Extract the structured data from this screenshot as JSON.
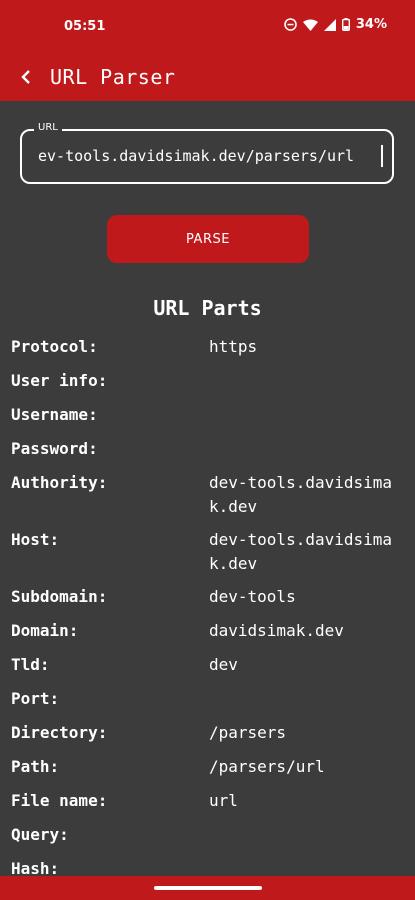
{
  "status": {
    "time": "05:51",
    "battery": "34%",
    "icons": [
      "do-not-disturb-icon",
      "wifi-icon",
      "signal-icon",
      "battery-icon"
    ]
  },
  "appbar": {
    "title": "URL Parser",
    "back_icon": "chevron-left-icon"
  },
  "url_input": {
    "label": "URL",
    "value": "ev-tools.davidsimak.dev/parsers/url"
  },
  "parse_button": {
    "label": "PARSE"
  },
  "results": {
    "title": "URL Parts",
    "rows": [
      {
        "key": "Protocol:",
        "value": "https"
      },
      {
        "key": "User info:",
        "value": ""
      },
      {
        "key": "Username:",
        "value": ""
      },
      {
        "key": "Password:",
        "value": ""
      },
      {
        "key": "Authority:",
        "value": "dev-tools.davidsimak.dev"
      },
      {
        "key": "Host:",
        "value": "dev-tools.davidsimak.dev"
      },
      {
        "key": "Subdomain:",
        "value": "dev-tools"
      },
      {
        "key": "Domain:",
        "value": "davidsimak.dev"
      },
      {
        "key": "Tld:",
        "value": "dev"
      },
      {
        "key": "Port:",
        "value": ""
      },
      {
        "key": "Directory:",
        "value": "/parsers"
      },
      {
        "key": "Path:",
        "value": "/parsers/url"
      },
      {
        "key": "File name:",
        "value": "url"
      },
      {
        "key": "Query:",
        "value": ""
      },
      {
        "key": "Hash:",
        "value": ""
      }
    ]
  },
  "colors": {
    "accent": "#c0191c",
    "background": "#3c3c3c",
    "text": "#ffffff"
  }
}
